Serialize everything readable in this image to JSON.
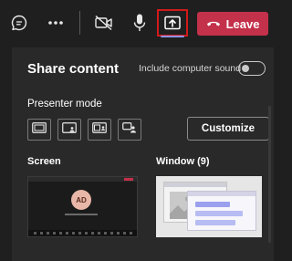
{
  "toolbar": {
    "buttons": {
      "chat": "chat-icon",
      "more": "more-icon",
      "camera": "camera-off-icon",
      "mic": "microphone-icon",
      "share": "share-tray-icon",
      "leave_icon": "phone-hangup-icon"
    },
    "leave_label": "Leave",
    "colors": {
      "leave": "#c4314b",
      "share_highlight": "#d11a1a",
      "active_underline": "#8f93f2"
    }
  },
  "share_panel": {
    "title": "Share content",
    "include_sound_label": "Include computer sound",
    "include_sound_on": false,
    "presenter_mode_label": "Presenter mode",
    "presenter_modes": [
      "content-only-icon",
      "standout-icon",
      "side-by-side-icon",
      "reporter-icon"
    ],
    "customize_label": "Customize",
    "screen_label": "Screen",
    "window_label": "Window (9)",
    "screen_preview": {
      "avatar_initials": "AD"
    }
  }
}
